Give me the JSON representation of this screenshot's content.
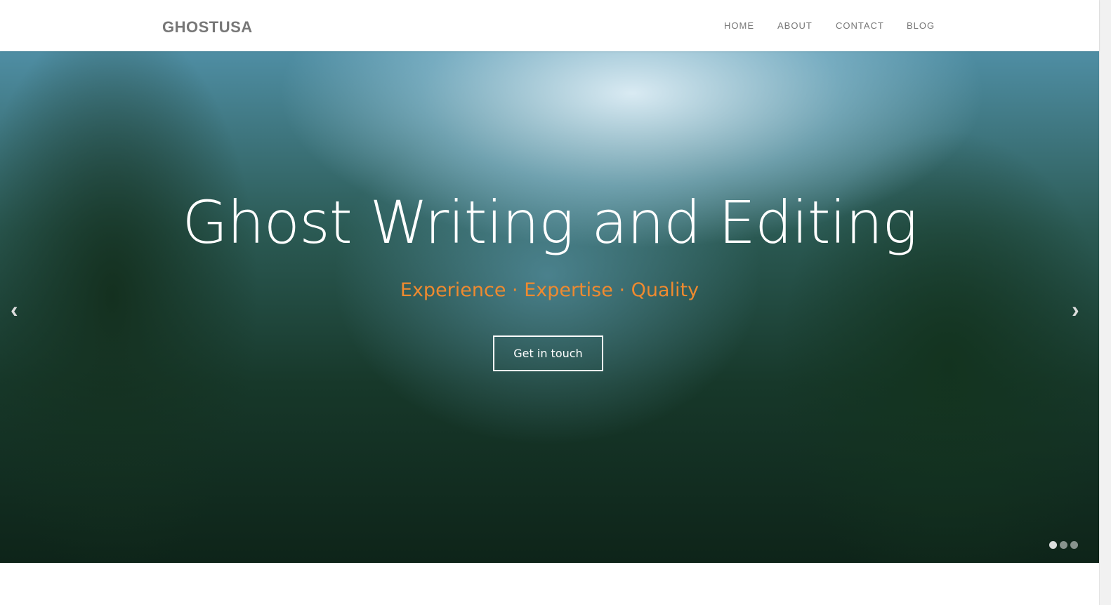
{
  "nav": {
    "logo": "GHOSTUSA",
    "items": [
      {
        "label": "HOME"
      },
      {
        "label": "ABOUT"
      },
      {
        "label": "CONTACT"
      },
      {
        "label": "BLOG"
      }
    ]
  },
  "hero": {
    "title": "Ghost Writing and Editing",
    "subtitle": "Experience · Expertise · Quality",
    "cta": "Get in touch",
    "prev_icon": "chevron-left-icon",
    "next_icon": "chevron-right-icon",
    "slides": 3,
    "active_slide": 1,
    "accent": "#ef8a2f"
  }
}
